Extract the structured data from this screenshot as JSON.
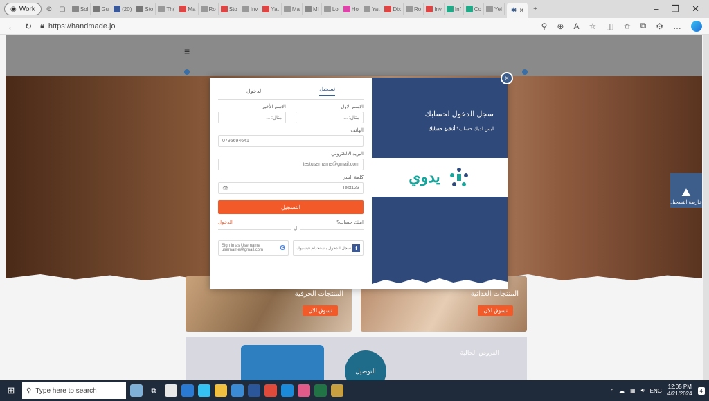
{
  "browser": {
    "profile_label": "Work",
    "tabs": [
      "Sol",
      "Gu",
      "(20)",
      "Sto",
      "Th(",
      "Ma",
      "Ro",
      "Sto",
      "Inv",
      "Yat",
      "Ma",
      "MI",
      "Lo",
      "Ho",
      "Yat",
      "Dix",
      "Ro",
      "Inv",
      "Inf",
      "Co",
      "Yel"
    ],
    "url": "https://handmade.jo"
  },
  "page": {
    "category_1": {
      "title": "المنتجات الحرفية",
      "button": "تسوق الان"
    },
    "category_2": {
      "title": "المنتجات الغذائية",
      "button": "تسوق الان"
    },
    "offers": {
      "title": "العروض الحالية",
      "badge": "التوصيل"
    },
    "side_widget": "خارطة التسجيل"
  },
  "modal": {
    "tab_login": "الدخول",
    "tab_register": "تسجيل",
    "first_name_label": "الاسم الاول",
    "first_name_placeholder": "مثال: ...",
    "last_name_label": "الاسم الأخير",
    "last_name_placeholder": "مثال: ...",
    "phone_label": "الهاتف",
    "phone_value": "0795694641",
    "email_label": "البريد الالكتروني",
    "email_value": "testusername@gmail.com",
    "password_label": "كلمة السر",
    "password_value": "Test123",
    "eye_icon": "👁",
    "submit_label": "التسجيل",
    "have_account": "املك حساب؟",
    "login_link": "الدخول",
    "or_text": "او",
    "facebook_label": "سجل الدخول باستخدام فيسبوك",
    "google_label": "Sign in as Username",
    "google_email": "username@gmail.com",
    "side_title": "سجل الدخول لحسابك",
    "side_sub_1": "ليس لديك حساب؟",
    "side_sub_2": "أنشئ حسابك",
    "logo_text": "يدوي",
    "close_icon": "×"
  },
  "taskbar": {
    "search_placeholder": "Type here to search",
    "lang": "ENG",
    "time": "12:05 PM",
    "date": "4/21/2024",
    "notif_count": "4"
  },
  "colors": {
    "accent": "#f25a2a",
    "primary": "#2f4a7a",
    "logo": "#1aa39a"
  }
}
